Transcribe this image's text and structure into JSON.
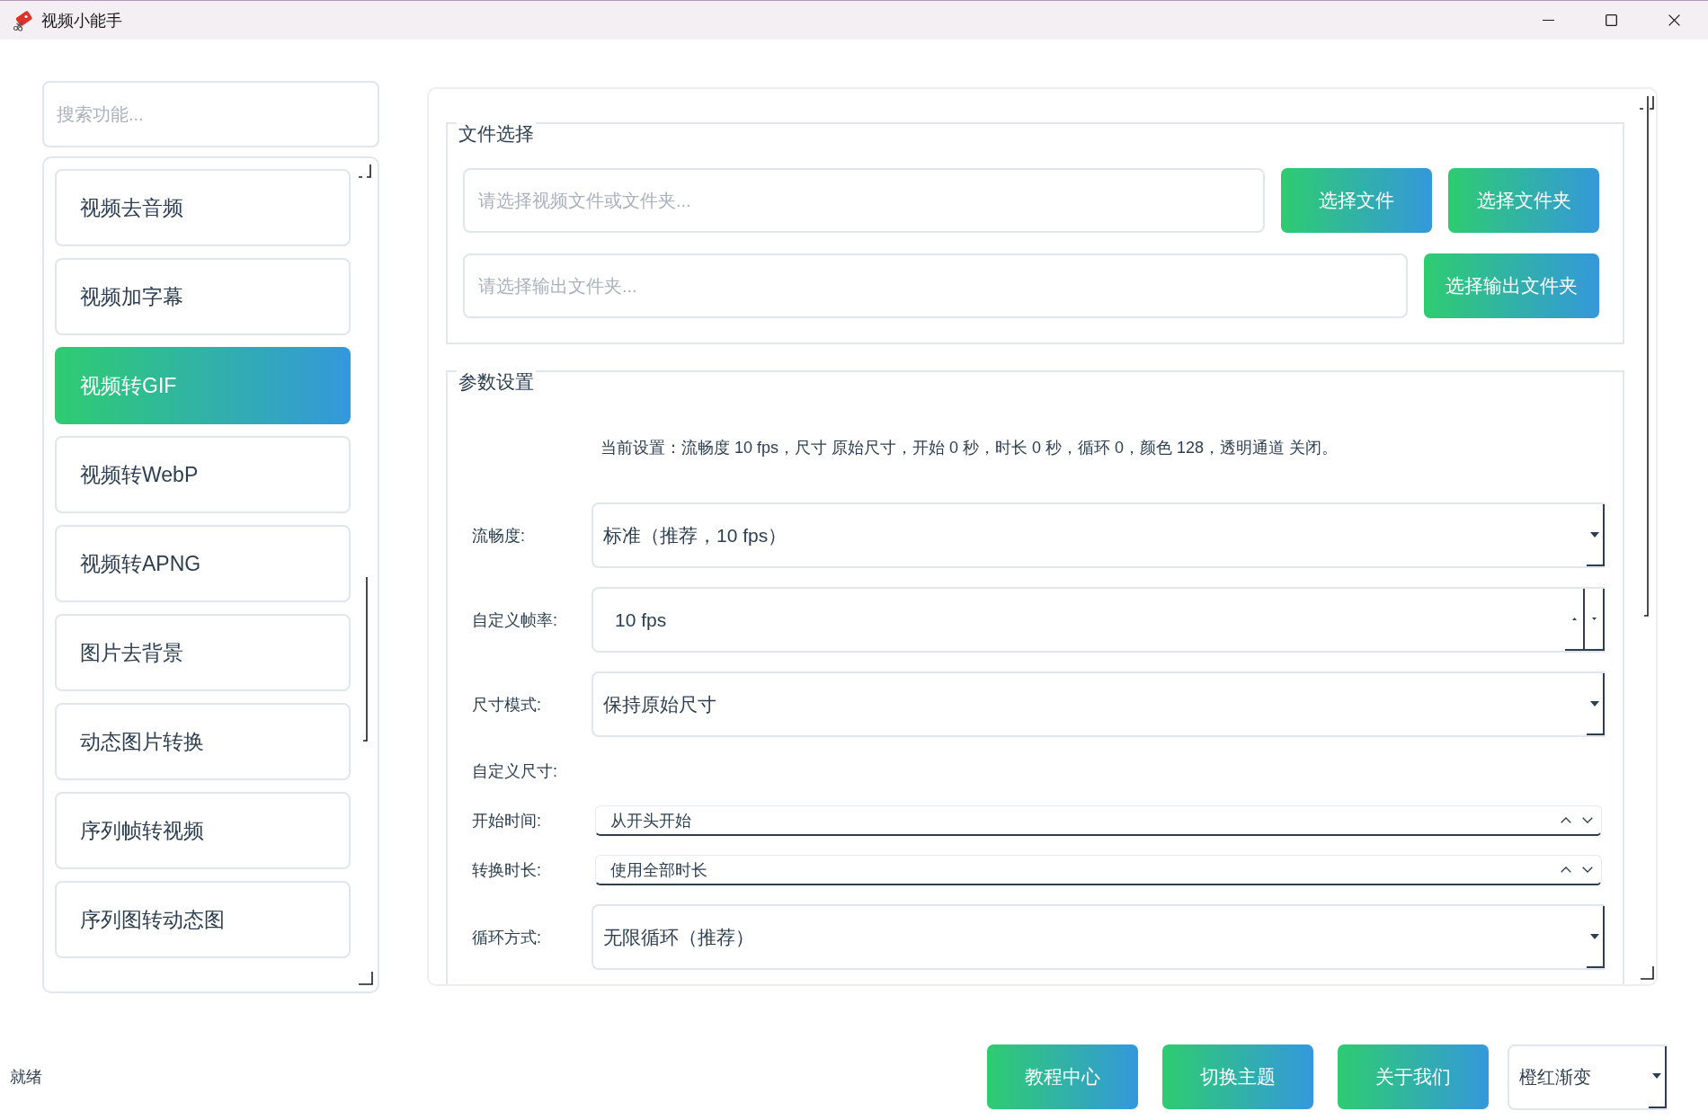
{
  "window": {
    "title": "视频小能手"
  },
  "sidebar": {
    "search": {
      "placeholder": "搜索功能..."
    },
    "items": [
      {
        "label": "视频去音频",
        "selected": false
      },
      {
        "label": "视频加字幕",
        "selected": false
      },
      {
        "label": "视频转GIF",
        "selected": true
      },
      {
        "label": "视频转WebP",
        "selected": false
      },
      {
        "label": "视频转APNG",
        "selected": false
      },
      {
        "label": "图片去背景",
        "selected": false
      },
      {
        "label": "动态图片转换",
        "selected": false
      },
      {
        "label": "序列帧转视频",
        "selected": false
      },
      {
        "label": "序列图转动态图",
        "selected": false
      }
    ]
  },
  "file_selection": {
    "title": "文件选择",
    "rows": [
      {
        "field": {
          "placeholder": "请选择视频文件或文件夹..."
        },
        "buttons": [
          "选择文件",
          "选择文件夹"
        ]
      },
      {
        "field": {
          "placeholder": "请选择输出文件夹..."
        },
        "buttons": [
          "选择输出文件夹"
        ]
      }
    ]
  },
  "parameters": {
    "title": "参数设置",
    "summary": "当前设置：流畅度 10 fps，尺寸 原始尺寸，开始 0 秒，时长 0 秒，循环 0，颜色 128，透明通道 关闭。",
    "rows": [
      {
        "kind": "combo",
        "label": "流畅度:",
        "value": "标准（推荐，10 fps）"
      },
      {
        "kind": "spin",
        "label": "自定义帧率:",
        "value": "10 fps"
      },
      {
        "kind": "combo",
        "label": "尺寸模式:",
        "value": "保持原始尺寸"
      },
      {
        "kind": "heading",
        "label": "自定义尺寸:"
      },
      {
        "kind": "time",
        "label": "开始时间:",
        "value": "从开头开始"
      },
      {
        "kind": "time",
        "label": "转换时长:",
        "value": "使用全部时长"
      },
      {
        "kind": "combo",
        "label": "循环方式:",
        "value": "无限循环（推荐）"
      }
    ]
  },
  "status_bar": {
    "text": "就绪",
    "buttons": [
      "教程中心",
      "切换主题",
      "关于我们"
    ],
    "theme": {
      "value": "橙红渐变"
    }
  }
}
